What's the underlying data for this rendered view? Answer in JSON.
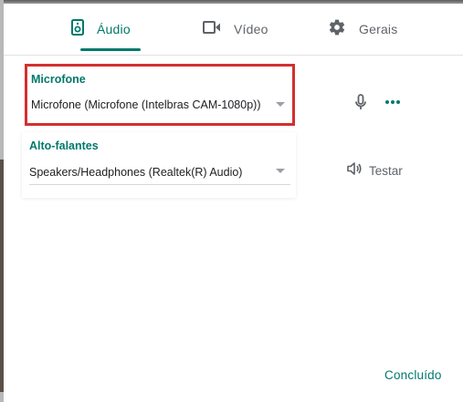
{
  "tabs": [
    {
      "label": "Áudio",
      "icon": "speaker-icon",
      "active": true
    },
    {
      "label": "Vídeo",
      "icon": "video-camera-icon",
      "active": false
    },
    {
      "label": "Gerais",
      "icon": "gear-icon",
      "active": false
    }
  ],
  "microphone": {
    "label": "Microfone",
    "value": "Microfone (Microfone (Intelbras CAM-1080p))"
  },
  "speakers": {
    "label": "Alto-falantes",
    "value": "Speakers/Headphones (Realtek(R) Audio)"
  },
  "test_label": "Testar",
  "done_label": "Concluído",
  "colors": {
    "accent": "#00796b",
    "highlight": "#d32f2f",
    "muted": "#5f6368"
  }
}
